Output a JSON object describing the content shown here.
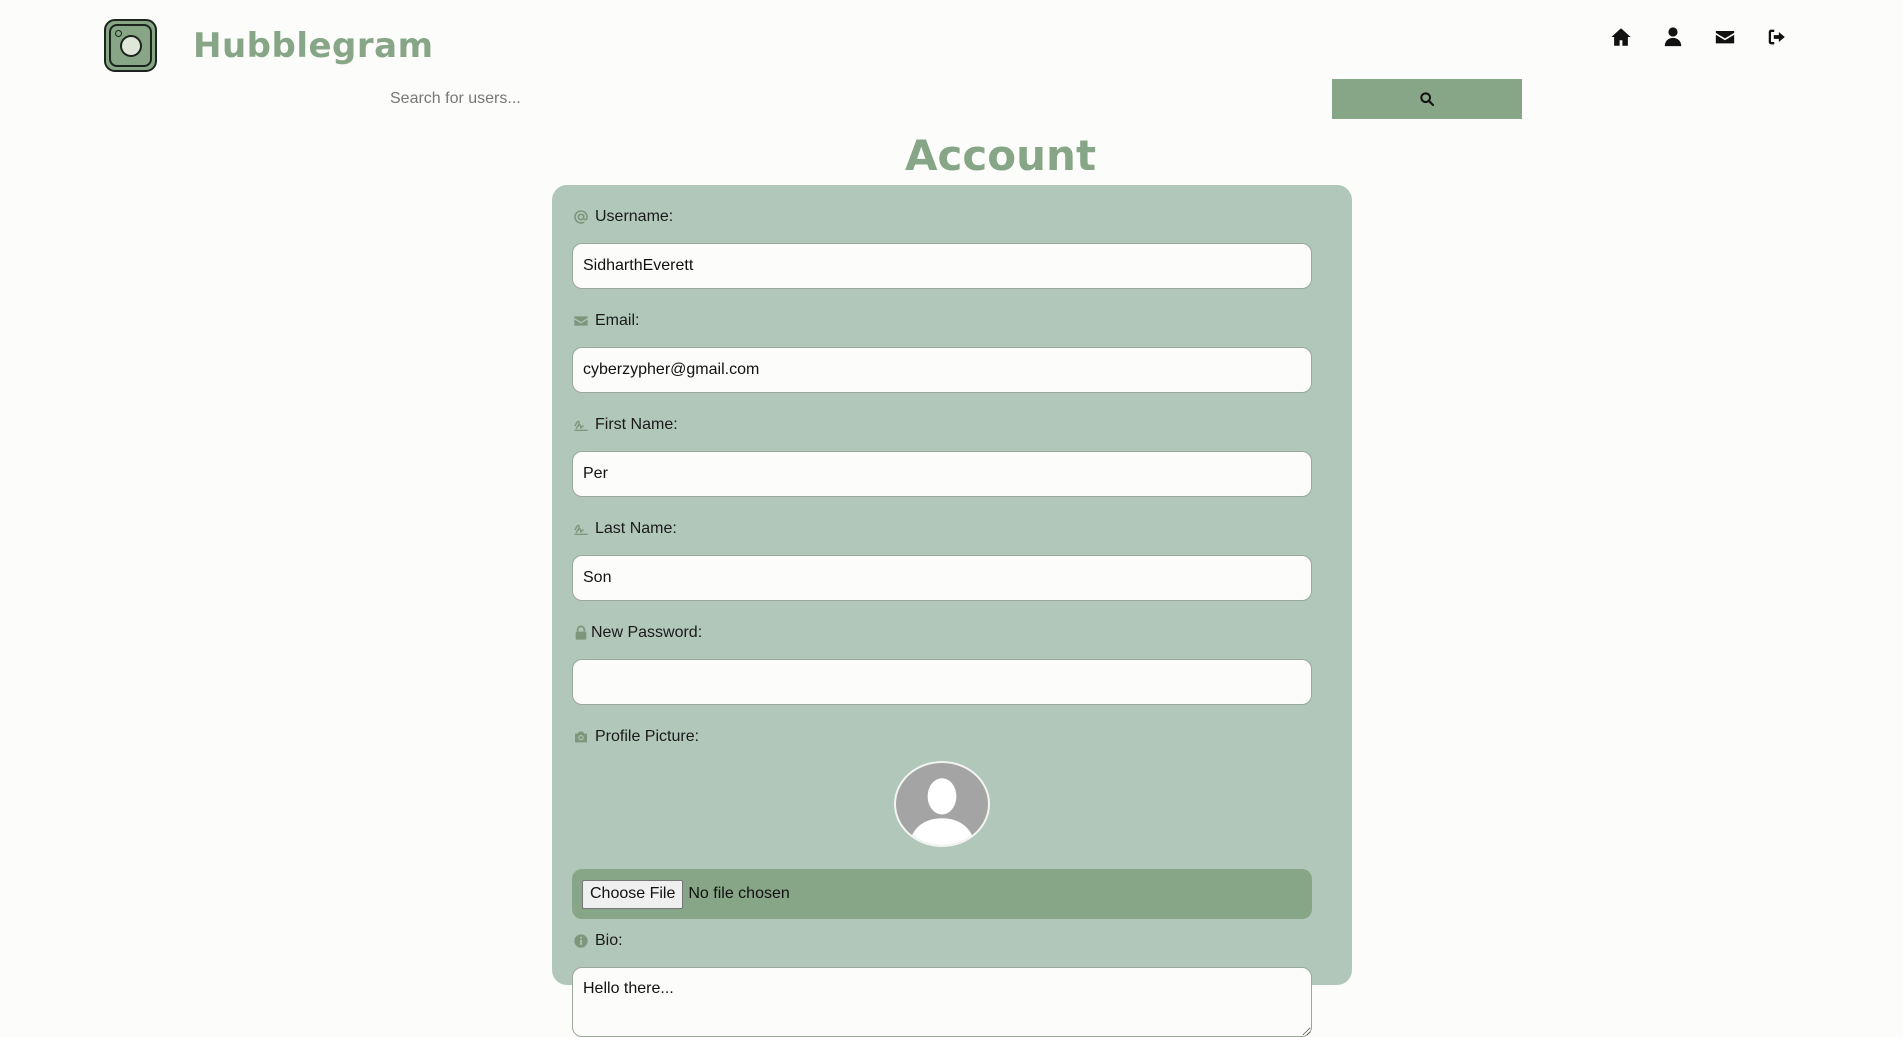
{
  "header": {
    "brand": "Hubblegram",
    "nav": [
      {
        "name": "home-icon"
      },
      {
        "name": "user-icon"
      },
      {
        "name": "envelope-icon"
      },
      {
        "name": "sign-out-icon"
      }
    ]
  },
  "search": {
    "placeholder": "Search for users...",
    "value": ""
  },
  "page": {
    "title": "Account"
  },
  "form": {
    "username": {
      "label": "Username:",
      "value": "SidharthEverett",
      "icon": "at-icon"
    },
    "email": {
      "label": "Email:",
      "value": "cyberzypher@gmail.com",
      "icon": "envelope-icon"
    },
    "first_name": {
      "label": "First Name:",
      "value": "Per",
      "icon": "signature-icon"
    },
    "last_name": {
      "label": "Last Name:",
      "value": "Son",
      "icon": "signature-icon"
    },
    "new_password": {
      "label": "New Password:",
      "value": "",
      "icon": "lock-icon"
    },
    "profile_picture": {
      "label": "Profile Picture:",
      "icon": "camera-icon",
      "choose_file_label": "Choose File",
      "file_status": "No file chosen"
    },
    "bio": {
      "label": "Bio:",
      "value": "Hello there...",
      "icon": "info-circle-icon"
    }
  },
  "colors": {
    "accent": "#87a587",
    "card": "#b1c7ba",
    "background": "#fcfdfa"
  }
}
